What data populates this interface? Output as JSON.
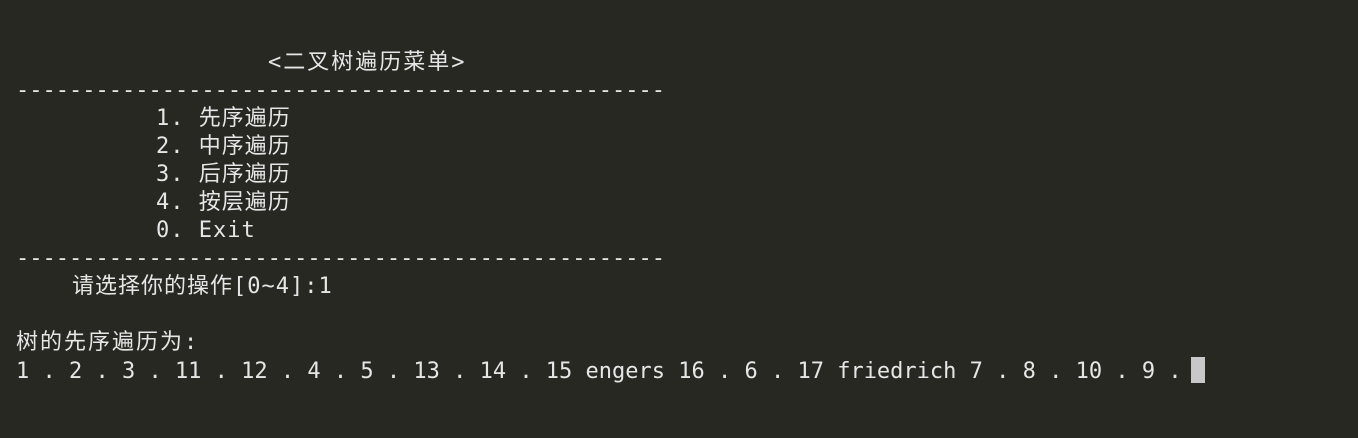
{
  "menu": {
    "title": "<二叉树遍历菜单>",
    "divider": "-------------------------------------------------",
    "items": [
      {
        "label": "1. 先序遍历"
      },
      {
        "label": "2. 中序遍历"
      },
      {
        "label": "3. 后序遍历"
      },
      {
        "label": "4. 按层遍历"
      },
      {
        "label": "0. Exit"
      }
    ]
  },
  "prompt": {
    "text": "请选择你的操作[0~4]:",
    "input": "1"
  },
  "result": {
    "label": "树的先序遍历为:",
    "output": "1 . 2 . 3 . 11 . 12 . 4 . 5 . 13 . 14 . 15 engers 16 . 6 . 17 friedrich 7 . 8 . 10 . 9 ."
  }
}
